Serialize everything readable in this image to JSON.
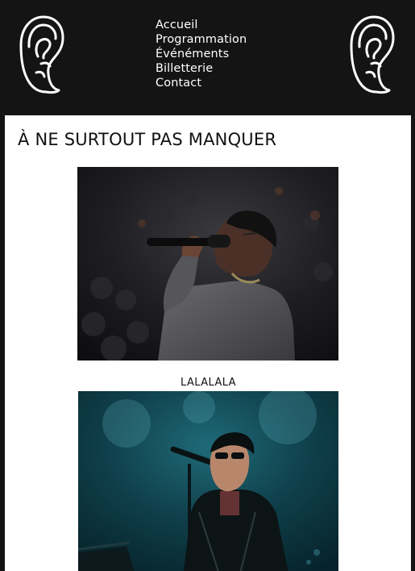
{
  "header": {
    "left_logo_icon": "ear-icon",
    "right_logo_icon": "ear-icon",
    "nav": [
      {
        "label": "Accueil"
      },
      {
        "label": "Programmation"
      },
      {
        "label": "Événéments"
      },
      {
        "label": "Billetterie"
      },
      {
        "label": "Contact"
      }
    ]
  },
  "main": {
    "section_title": "À NE SURTOUT PAS MANQUER",
    "items": [
      {
        "caption": ""
      },
      {
        "caption": "LALALALA"
      }
    ]
  },
  "colors": {
    "header_background": "#141414",
    "content_background": "#ffffff",
    "nav_text": "#ffffff"
  }
}
